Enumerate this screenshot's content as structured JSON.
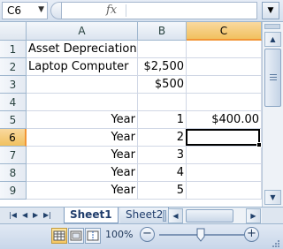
{
  "formula_bar": {
    "name_box": "C6",
    "fx_label": "fx",
    "formula": ""
  },
  "columns": [
    "A",
    "B",
    "C"
  ],
  "selected_column": "C",
  "rows": [
    {
      "num": "1",
      "a": "Asset Depreciation",
      "b": "",
      "c": ""
    },
    {
      "num": "2",
      "a": "Laptop Computer",
      "b": "$2,500",
      "c": ""
    },
    {
      "num": "3",
      "a": "",
      "b": "$500",
      "c": ""
    },
    {
      "num": "4",
      "a": "",
      "b": "",
      "c": ""
    },
    {
      "num": "5",
      "a": "Year",
      "b": "1",
      "c": "$400.00"
    },
    {
      "num": "6",
      "a": "Year",
      "b": "2",
      "c": ""
    },
    {
      "num": "7",
      "a": "Year",
      "b": "3",
      "c": ""
    },
    {
      "num": "8",
      "a": "Year",
      "b": "4",
      "c": ""
    },
    {
      "num": "9",
      "a": "Year",
      "b": "5",
      "c": ""
    }
  ],
  "selected_row": "6",
  "sheet_tabs": {
    "active": "Sheet1",
    "other": "Sheet2"
  },
  "status_bar": {
    "zoom": "100%",
    "zoom_out": "−",
    "zoom_in": "+"
  },
  "icons": {
    "name_dropdown": "chevron-down-icon",
    "expand": "double-chevron-down-icon"
  }
}
